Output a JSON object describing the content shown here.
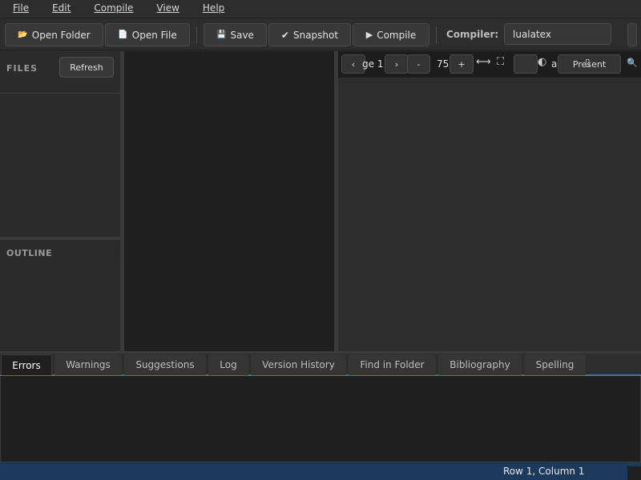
{
  "menubar": {
    "items": [
      "File",
      "Edit",
      "Compile",
      "View",
      "Help"
    ]
  },
  "toolbar": {
    "open_folder": "Open Folder",
    "open_file": "Open File",
    "save": "Save",
    "snapshot": "Snapshot",
    "compile": "Compile",
    "compiler_label": "Compiler:",
    "compiler_value": "lualatex"
  },
  "files_panel": {
    "title": "FILES",
    "refresh": "Refresh"
  },
  "outline_panel": {
    "title": "OUTLINE"
  },
  "viewer": {
    "prev": "‹",
    "page_text": "ge 1",
    "next": "›",
    "zoom_out": "-",
    "zoom_value": "75",
    "zoom_in": "+",
    "present_label": "Present",
    "partial_label": "a"
  },
  "bottom_tabs": {
    "items": [
      "Errors",
      "Warnings",
      "Suggestions",
      "Log",
      "Version History",
      "Find in Folder",
      "Bibliography",
      "Spelling"
    ],
    "active": "Errors"
  },
  "statusbar": {
    "position": "Row 1, Column 1"
  },
  "colors": {
    "accent": "#4a6fa5",
    "statusbar": "#1d3a5c"
  }
}
